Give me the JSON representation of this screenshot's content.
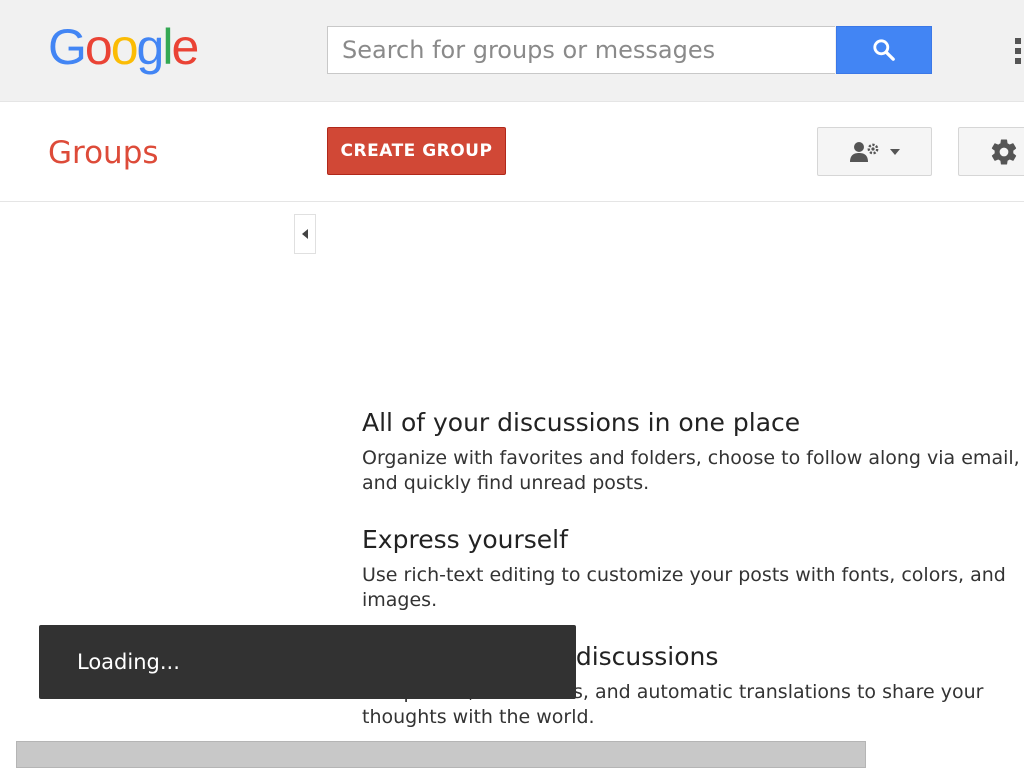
{
  "header": {
    "logo_letters": [
      {
        "char": "G",
        "color": "#4285f4"
      },
      {
        "char": "o",
        "color": "#ea4335"
      },
      {
        "char": "o",
        "color": "#fbbc05"
      },
      {
        "char": "g",
        "color": "#4285f4"
      },
      {
        "char": "l",
        "color": "#34a853"
      },
      {
        "char": "e",
        "color": "#ea4335"
      }
    ],
    "search_placeholder": "Search for groups or messages",
    "search_icon": "search-icon",
    "apps_icon": "apps-icon"
  },
  "subbar": {
    "title": "Groups",
    "create_button_label": "CREATE GROUP",
    "account_icon": "manage-account-icon",
    "settings_icon": "gear-icon"
  },
  "features": [
    {
      "title": "All of your discussions in one place",
      "description": "Organize with favorites and folders, choose to follow along via email, and quickly find unread posts."
    },
    {
      "title": "Express yourself",
      "description": "Use rich-text editing to customize your posts with fonts, colors, and images."
    },
    {
      "title": "Personalize your discussions",
      "description": "Use photos, nicknames, and automatic translations to share your thoughts with the world."
    }
  ],
  "toast": {
    "message": "Loading..."
  },
  "colors": {
    "accent_red": "#dd4b39",
    "button_red": "#d14836",
    "search_blue": "#4285f4"
  }
}
